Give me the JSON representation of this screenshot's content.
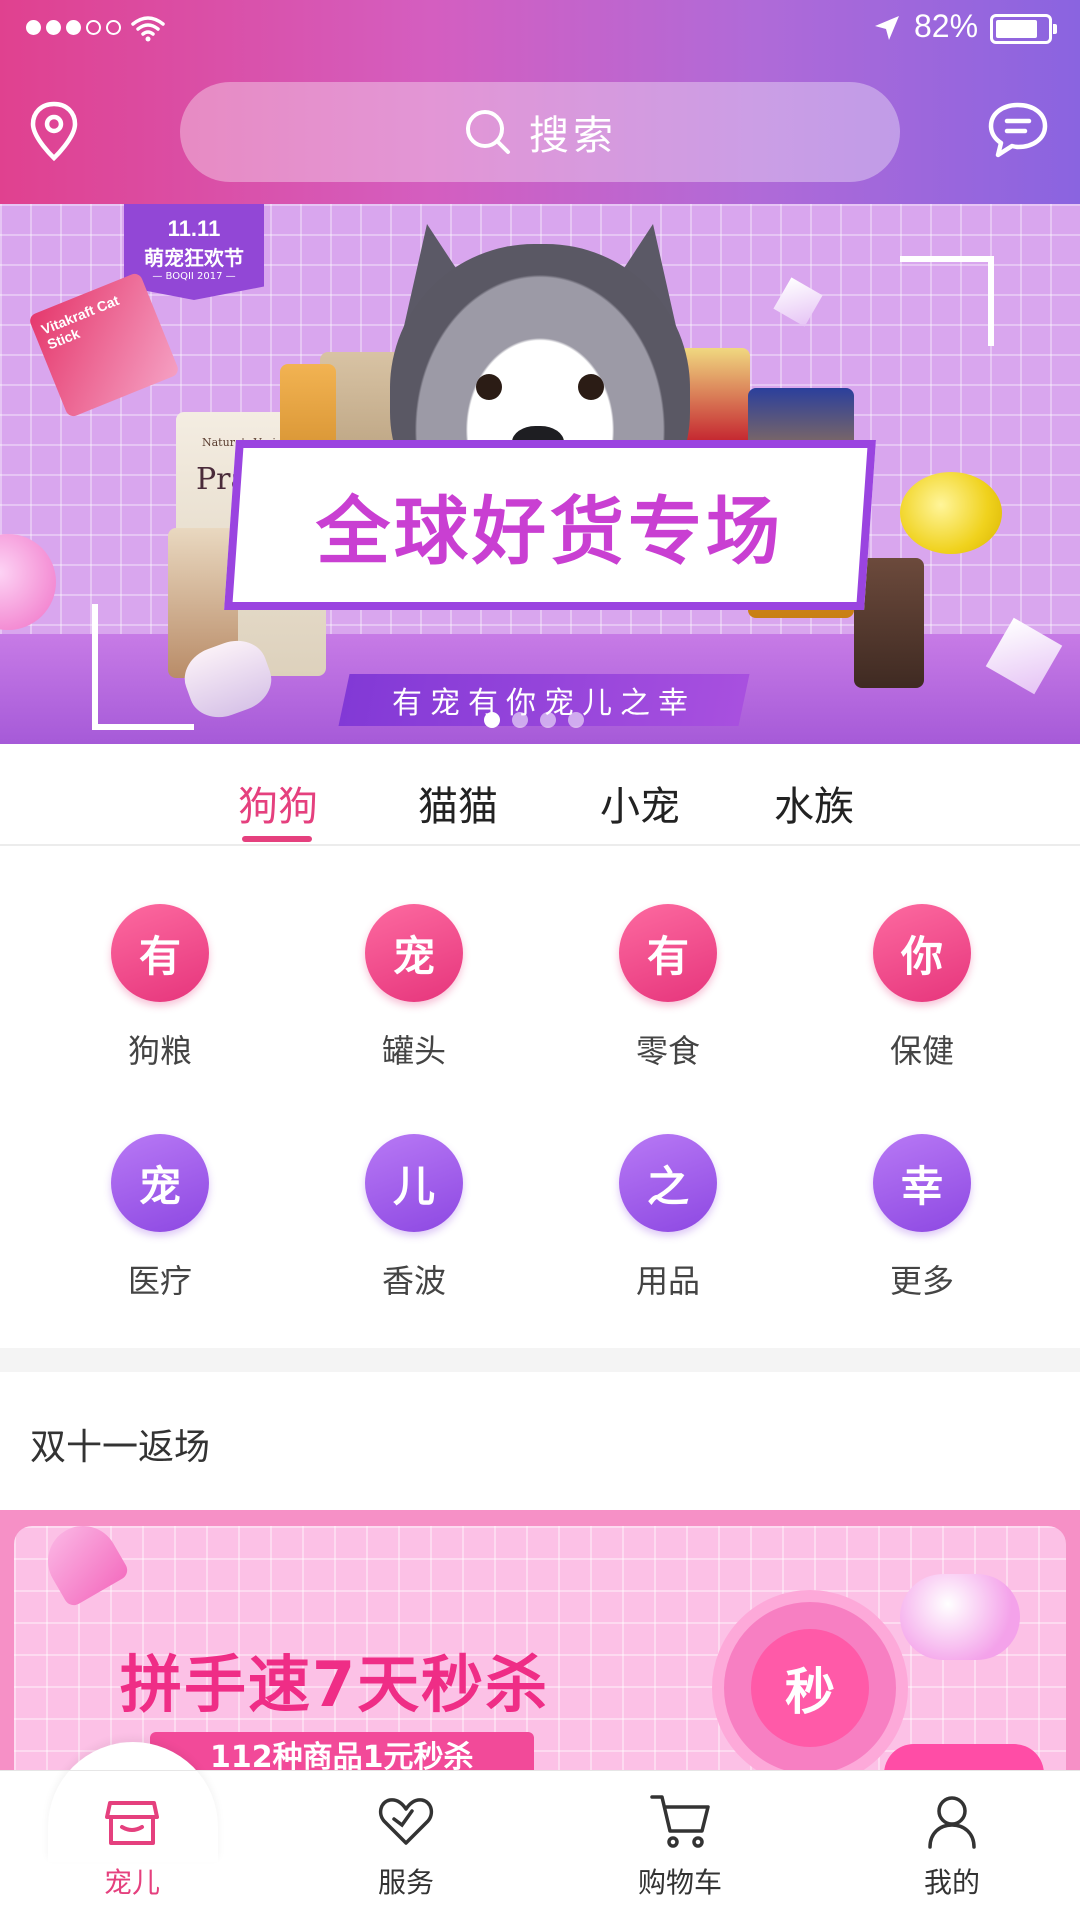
{
  "status_bar": {
    "battery": "82%",
    "battery_level": 0.82,
    "signal_bars": 3
  },
  "header": {
    "search_placeholder": "搜索"
  },
  "banner": {
    "event_date": "11.11",
    "event_name": "萌宠狂欢节",
    "event_sub": "— BOQII 2017 —",
    "title": "全球好货专场",
    "subtitle": "有宠有你宠儿之幸",
    "products": [
      "Vitakraft Cat Stick",
      "Prairie",
      "Nature's Variety",
      "gold"
    ],
    "page_count": 4,
    "active_page": 1
  },
  "tabs": [
    {
      "label": "狗狗",
      "active": true
    },
    {
      "label": "猫猫",
      "active": false
    },
    {
      "label": "小宠",
      "active": false
    },
    {
      "label": "水族",
      "active": false
    }
  ],
  "categories": [
    {
      "glyph": "有",
      "label": "狗粮",
      "color": "pink"
    },
    {
      "glyph": "宠",
      "label": "罐头",
      "color": "pink"
    },
    {
      "glyph": "有",
      "label": "零食",
      "color": "pink"
    },
    {
      "glyph": "你",
      "label": "保健",
      "color": "pink"
    },
    {
      "glyph": "宠",
      "label": "医疗",
      "color": "purple"
    },
    {
      "glyph": "儿",
      "label": "香波",
      "color": "purple"
    },
    {
      "glyph": "之",
      "label": "用品",
      "color": "purple"
    },
    {
      "glyph": "幸",
      "label": "更多",
      "color": "purple"
    }
  ],
  "section": {
    "title": "双十一返场",
    "promo_title": "拼手速7天秒杀",
    "promo_subtitle": "112种商品1元秒杀",
    "promo_clock": "秒"
  },
  "bottom_nav": [
    {
      "label": "宠儿",
      "icon": "shop-icon",
      "active": true
    },
    {
      "label": "服务",
      "icon": "heart-icon",
      "active": false
    },
    {
      "label": "购物车",
      "icon": "cart-icon",
      "active": false
    },
    {
      "label": "我的",
      "icon": "user-icon",
      "active": false
    }
  ],
  "colors": {
    "accent": "#e5407e",
    "pink": "#e6357c",
    "purple": "#8d48e2"
  }
}
